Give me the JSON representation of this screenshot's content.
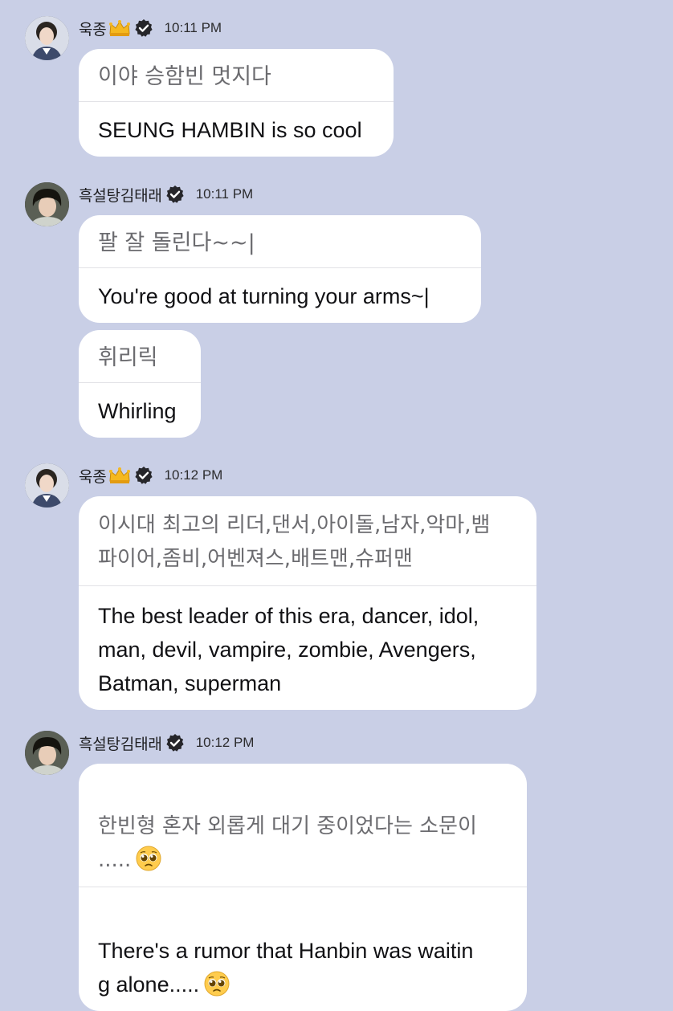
{
  "messages": [
    {
      "sender": "욱종",
      "crown": true,
      "time": "10:11 PM",
      "original": "이야 승함빈 멋지다",
      "translation": "SEUNG HAMBIN is so cool"
    },
    {
      "sender": "흑설탕김태래",
      "crown": false,
      "time": "10:11 PM",
      "original": "팔 잘 돌린다~~|",
      "translation": "You're good at turning your arms~|"
    },
    {
      "sender": "흑설탕김태래",
      "crown": false,
      "time": "",
      "original": "휘리릭",
      "translation": "Whirling"
    },
    {
      "sender": "욱종",
      "crown": true,
      "time": "10:12 PM",
      "original": "이시대 최고의 리더,댄서,아이돌,남자,악마,뱀\n파이어,좀비,어벤져스,배트맨,슈퍼맨",
      "translation": "The best leader of this era, dancer, idol,\n man, devil, vampire, zombie, Avengers,\nBatman, superman"
    },
    {
      "sender": "흑설탕김태래",
      "crown": false,
      "time": "10:12 PM",
      "original": "한빈형 혼자 외롭게 대기 중이었다는 소문이\n.....",
      "translation": "There's a rumor that Hanbin was waitin\ng alone.....",
      "emoji": "pleading-face-icon"
    }
  ],
  "colors": {
    "background": "#c9cfe6",
    "bubble": "#ffffff",
    "original_text": "#6b6b6f",
    "translation_text": "#111114"
  }
}
